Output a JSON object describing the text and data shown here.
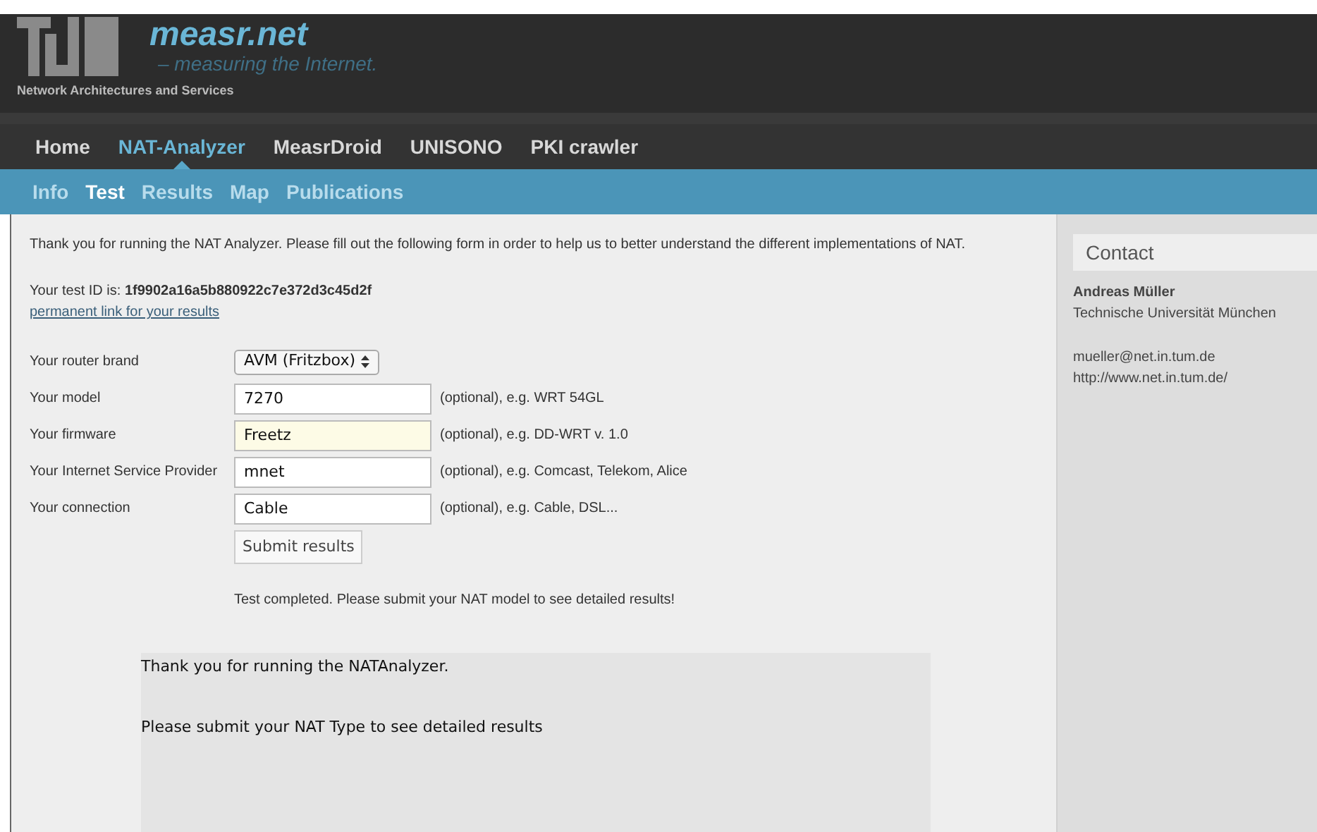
{
  "header": {
    "site_name": "measr.net",
    "tagline": "– measuring the Internet.",
    "group": "Network Architectures and Services"
  },
  "nav": [
    {
      "label": "Home",
      "selected": false
    },
    {
      "label": "NAT-Analyzer",
      "selected": true
    },
    {
      "label": "MeasrDroid",
      "selected": false
    },
    {
      "label": "UNISONO",
      "selected": false
    },
    {
      "label": "PKI crawler",
      "selected": false
    }
  ],
  "subnav": [
    {
      "label": "Info",
      "selected": false
    },
    {
      "label": "Test",
      "selected": true
    },
    {
      "label": "Results",
      "selected": false
    },
    {
      "label": "Map",
      "selected": false
    },
    {
      "label": "Publications",
      "selected": false
    }
  ],
  "intro": "Thank you for running the NAT Analyzer. Please fill out the following form in order to help us to better understand the different implementations of NAT.",
  "test_id": "Your test ID is: **1f9902a16a5b880922c7e372d3c45d2f**",
  "permalink": "permanent link for your results",
  "form": [
    {
      "kind": "select",
      "label": "Your router brand",
      "value": "AVM (Fritzbox)"
    },
    {
      "kind": "text",
      "label": "Your model",
      "value": "7270",
      "focused": false,
      "hint": "(optional), e.g. WRT 54GL"
    },
    {
      "kind": "text",
      "label": "Your firmware",
      "value": "Freetz",
      "focused": true,
      "hint": "(optional), e.g. DD-WRT v. 1.0"
    },
    {
      "kind": "text",
      "label": "Your Internet Service Provider",
      "value": "mnet",
      "focused": false,
      "hint": "(optional), e.g. Comcast, Telekom, Alice"
    },
    {
      "kind": "text",
      "label": "Your connection",
      "value": "Cable",
      "focused": false,
      "hint": "(optional), e.g. Cable, DSL..."
    }
  ],
  "submit": "Submit results",
  "status": "Test completed. Please submit your NAT model to see detailed results!",
  "result_box": [
    "Thank you for running the NATAnalyzer.",
    "Please submit your NAT Type to see detailed results"
  ],
  "contact": {
    "title": "Contact",
    "name": "Andreas Müller",
    "org": "Technische Universität München",
    "email": "mueller@net.in.tum.de",
    "url": "http://www.net.in.tum.de/"
  }
}
